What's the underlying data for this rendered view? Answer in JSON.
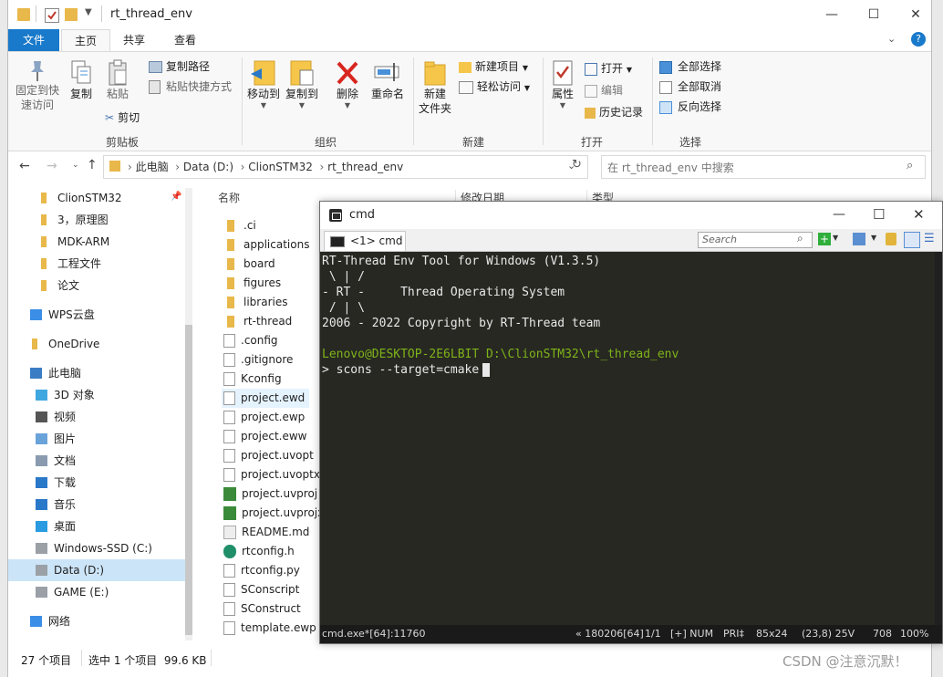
{
  "explorer": {
    "title": "rt_thread_env",
    "tabs": [
      "文件",
      "主页",
      "共享",
      "查看"
    ],
    "ribbon": {
      "pin": "固定到快\n速访问",
      "copy": "复制",
      "paste": "粘贴",
      "copy_path": "复制路径",
      "paste_shortcut": "粘贴快捷方式",
      "cut": "剪切",
      "clipboard_group": "剪贴板",
      "move_to": "移动到",
      "copy_to": "复制到",
      "delete": "删除",
      "rename": "重命名",
      "organize_group": "组织",
      "new_folder": "新建\n文件夹",
      "new_item": "新建项目",
      "easy_access": "轻松访问",
      "new_group": "新建",
      "properties": "属性",
      "open": "打开",
      "edit": "编辑",
      "history": "历史记录",
      "open_group": "打开",
      "select_all": "全部选择",
      "select_none": "全部取消",
      "invert_selection": "反向选择",
      "select_group": "选择"
    },
    "breadcrumb": [
      "此电脑",
      "Data (D:)",
      "ClionSTM32",
      "rt_thread_env"
    ],
    "search_placeholder": "在 rt_thread_env 中搜索",
    "nav_items": [
      {
        "label": "ClionSTM32",
        "icon": "folder-icon"
      },
      {
        "label": "3，原理图",
        "icon": "folder-icon"
      },
      {
        "label": "MDK-ARM",
        "icon": "folder-icon"
      },
      {
        "label": "工程文件",
        "icon": "folder-icon"
      },
      {
        "label": "论文",
        "icon": "folder-icon"
      },
      {
        "label": "WPS云盘",
        "icon": "cloud-icon"
      },
      {
        "label": "OneDrive",
        "icon": "folder-icon"
      },
      {
        "label": "此电脑",
        "icon": "pc-icon"
      },
      {
        "label": "3D 对象",
        "icon": "3d-icon"
      },
      {
        "label": "视频",
        "icon": "video-icon"
      },
      {
        "label": "图片",
        "icon": "picture-icon"
      },
      {
        "label": "文档",
        "icon": "document-icon"
      },
      {
        "label": "下载",
        "icon": "download-icon"
      },
      {
        "label": "音乐",
        "icon": "music-icon"
      },
      {
        "label": "桌面",
        "icon": "desktop-icon"
      },
      {
        "label": "Windows-SSD (C:)",
        "icon": "drive-icon"
      },
      {
        "label": "Data (D:)",
        "icon": "drive-icon"
      },
      {
        "label": "GAME (E:)",
        "icon": "drive-icon"
      },
      {
        "label": "网络",
        "icon": "network-icon"
      }
    ],
    "columns": {
      "name": "名称",
      "modified": "修改日期",
      "type": "类型"
    },
    "files": [
      {
        "name": ".ci",
        "kind": "folder"
      },
      {
        "name": "applications",
        "kind": "folder"
      },
      {
        "name": "board",
        "kind": "folder"
      },
      {
        "name": "figures",
        "kind": "folder"
      },
      {
        "name": "libraries",
        "kind": "folder"
      },
      {
        "name": "rt-thread",
        "kind": "folder"
      },
      {
        "name": ".config",
        "kind": "file"
      },
      {
        "name": ".gitignore",
        "kind": "file"
      },
      {
        "name": "Kconfig",
        "kind": "file"
      },
      {
        "name": "project.ewd",
        "kind": "file"
      },
      {
        "name": "project.ewp",
        "kind": "file"
      },
      {
        "name": "project.eww",
        "kind": "file"
      },
      {
        "name": "project.uvopt",
        "kind": "file"
      },
      {
        "name": "project.uvoptx",
        "kind": "file"
      },
      {
        "name": "project.uvproj",
        "kind": "keil"
      },
      {
        "name": "project.uvprojx",
        "kind": "keil"
      },
      {
        "name": "README.md",
        "kind": "md"
      },
      {
        "name": "rtconfig.h",
        "kind": "header"
      },
      {
        "name": "rtconfig.py",
        "kind": "file"
      },
      {
        "name": "SConscript",
        "kind": "file"
      },
      {
        "name": "SConstruct",
        "kind": "file"
      },
      {
        "name": "template.ewp",
        "kind": "file"
      }
    ],
    "status": {
      "count": "27 个项目",
      "selected": "选中 1 个项目  99.6 KB"
    }
  },
  "cmd": {
    "title": "cmd",
    "tab_label": "<1> cmd",
    "search_placeholder": "Search",
    "lines": [
      "RT-Thread Env Tool for Windows (V1.3.5)",
      " \\ | /",
      "- RT -     Thread Operating System",
      " / | \\",
      "2006 - 2022 Copyright by RT-Thread team",
      "",
      "Lenovo@DESKTOP-2E6LBIT D:\\ClionSTM32\\rt_thread_env",
      "> scons --target=cmake"
    ],
    "prompt_color": "#7fb31a",
    "status": {
      "process": "cmd.exe*[64]:11760",
      "buffer": "« 180206[64]",
      "page": "1/1",
      "mode": "[+] NUM",
      "pri": "PRI‡",
      "size": "85x24",
      "pos": "(23,8) 25V",
      "num": "708",
      "zoom": "100%"
    }
  },
  "watermark": "CSDN @注意沉默！"
}
